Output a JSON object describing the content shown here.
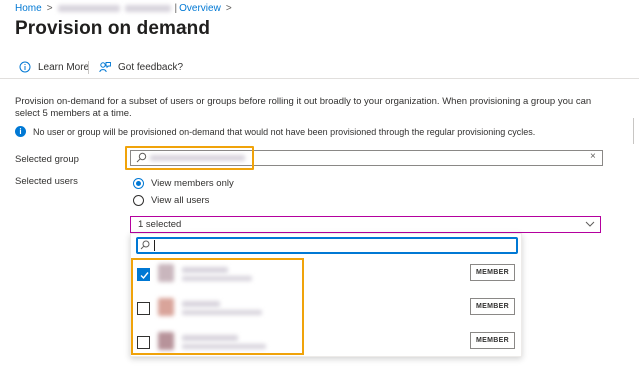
{
  "breadcrumb": {
    "home": "Home",
    "separator": ">",
    "overview": "Overview"
  },
  "page": {
    "title": "Provision on demand",
    "more": "···"
  },
  "toolbar": {
    "learn_more": "Learn More",
    "feedback": "Got feedback?"
  },
  "description": "Provision on-demand for a subset of users or groups before rolling it out broadly to your organization. When provisioning a group you can select 5 members at a time.",
  "info_text": "No user or group will be provisioned on-demand that would not have been provisioned through the regular provisioning cycles.",
  "form": {
    "selected_group_label": "Selected group",
    "selected_users_label": "Selected users",
    "clear_icon": "×",
    "radio_members_only": "View members only",
    "radio_all_users": "View all users",
    "dropdown_value": "1 selected"
  },
  "users": [
    {
      "checked": true,
      "member_label": "MEMBER",
      "avatar_color": "#c9b6bd"
    },
    {
      "checked": false,
      "member_label": "MEMBER",
      "avatar_color": "#d9a49a"
    },
    {
      "checked": false,
      "member_label": "MEMBER",
      "avatar_color": "#b7939a"
    }
  ],
  "colors": {
    "accent": "#0078d4",
    "highlight": "#f0a30a",
    "dropdown_border": "#b4009e"
  }
}
